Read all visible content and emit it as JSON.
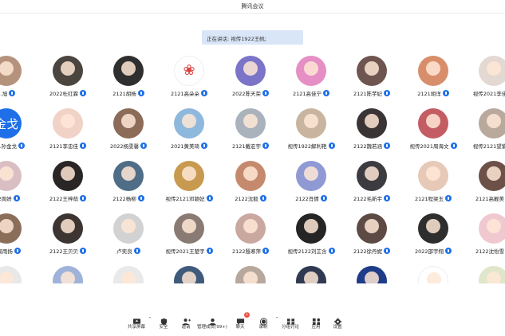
{
  "window": {
    "title": "腾讯会议"
  },
  "speaker": {
    "text": "正在讲话: 视传1922王帆;"
  },
  "participants": [
    {
      "name": "...旭",
      "avatar_color": "#b5927c",
      "avatar_text": ""
    },
    {
      "name": "2022杜红霖",
      "avatar_color": "#4b4540",
      "avatar_text": ""
    },
    {
      "name": "2121胡杨",
      "avatar_color": "#2f2f2f",
      "avatar_text": ""
    },
    {
      "name": "2121高朵朵",
      "avatar_color": "#ffffff",
      "avatar_text": "❀"
    },
    {
      "name": "2022陈天荣",
      "avatar_color": "#7b74c9",
      "avatar_text": ""
    },
    {
      "name": "2121高佳宁",
      "avatar_color": "#e68fc4",
      "avatar_text": ""
    },
    {
      "name": "2121陈芋妃",
      "avatar_color": "#6e5550",
      "avatar_text": ""
    },
    {
      "name": "2121胡洋",
      "avatar_color": "#d98e6b",
      "avatar_text": ""
    },
    {
      "name": "视传2021李佳",
      "avatar_color": "#e3d8d2",
      "avatar_text": ""
    },
    {
      "name": "2121孙金戈",
      "avatar_color": "#1e6fe8",
      "avatar_text": "金戈"
    },
    {
      "name": "2121李忠佳",
      "avatar_color": "#f0d2c6",
      "avatar_text": ""
    },
    {
      "name": "2022杨雯馨",
      "avatar_color": "#8c6b58",
      "avatar_text": ""
    },
    {
      "name": "2021黄美琦",
      "avatar_color": "#8fb8dd",
      "avatar_text": ""
    },
    {
      "name": "2121戴宏宇",
      "avatar_color": "#aab2bc",
      "avatar_text": ""
    },
    {
      "name": "视传1922解利艳",
      "avatar_color": "#c9b59f",
      "avatar_text": ""
    },
    {
      "name": "2122魏若涵",
      "avatar_color": "#3a3434",
      "avatar_text": ""
    },
    {
      "name": "视传2021周海文",
      "avatar_color": "#c45d63",
      "avatar_text": ""
    },
    {
      "name": "视传2121望紫",
      "avatar_color": "#b9a89c",
      "avatar_text": ""
    },
    {
      "name": "...2周妍",
      "avatar_color": "#d9bfc4",
      "avatar_text": ""
    },
    {
      "name": "2122王梓萌",
      "avatar_color": "#2b2626",
      "avatar_text": ""
    },
    {
      "name": "2122杨柳",
      "avatar_color": "#4f6d86",
      "avatar_text": ""
    },
    {
      "name": "视传2121邓颖妃",
      "avatar_color": "#c79a4f",
      "avatar_text": ""
    },
    {
      "name": "2122沈毅",
      "avatar_color": "#c58a6d",
      "avatar_text": ""
    },
    {
      "name": "2122肖倩",
      "avatar_color": "#8f99d4",
      "avatar_text": ""
    },
    {
      "name": "2122毛新宇",
      "avatar_color": "#3b3b40",
      "avatar_text": ""
    },
    {
      "name": "2121程梁玉",
      "avatar_color": "#e7c9b8",
      "avatar_text": ""
    },
    {
      "name": "2121高靓美",
      "avatar_color": "#6d5048",
      "avatar_text": ""
    },
    {
      "name": "...周雨扬",
      "avatar_color": "#8b6e5a",
      "avatar_text": ""
    },
    {
      "name": "2122王贝贝",
      "avatar_color": "#3c3532",
      "avatar_text": ""
    },
    {
      "name": "卢奕良",
      "avatar_color": "#d2d2d2",
      "avatar_text": ""
    },
    {
      "name": "视传2021王楚宇",
      "avatar_color": "#8a7a74",
      "avatar_text": ""
    },
    {
      "name": "2122殷寒萍",
      "avatar_color": "#c9a8a0",
      "avatar_text": ""
    },
    {
      "name": "视传2122刘芷含",
      "avatar_color": "#252525",
      "avatar_text": ""
    },
    {
      "name": "2122徐丹妮",
      "avatar_color": "#5e4a44",
      "avatar_text": ""
    },
    {
      "name": "2022邵宇翔",
      "avatar_color": "#2e2e2e",
      "avatar_text": ""
    },
    {
      "name": "2122沈怡雪",
      "avatar_color": "#f0c8cf",
      "avatar_text": ""
    },
    {
      "name": "",
      "avatar_color": "#e8e8e8",
      "avatar_text": ""
    },
    {
      "name": "",
      "avatar_color": "#9fb3d9",
      "avatar_text": ""
    },
    {
      "name": "",
      "avatar_color": "#e9e9e9",
      "avatar_text": ""
    },
    {
      "name": "",
      "avatar_color": "#3f5a7a",
      "avatar_text": ""
    },
    {
      "name": "",
      "avatar_color": "#b8a79c",
      "avatar_text": ""
    },
    {
      "name": "",
      "avatar_color": "#2f3a52",
      "avatar_text": ""
    },
    {
      "name": "",
      "avatar_color": "#1f3c88",
      "avatar_text": ""
    },
    {
      "name": "",
      "avatar_color": "#ffffff",
      "avatar_text": ""
    },
    {
      "name": "",
      "avatar_color": "#dfe6c9",
      "avatar_text": ""
    }
  ],
  "toolbar": [
    {
      "label": "共享屏幕",
      "icon": "share-screen-icon",
      "caret": true
    },
    {
      "label": "安全",
      "icon": "shield-icon",
      "caret": false
    },
    {
      "label": "邀请",
      "icon": "invite-icon",
      "caret": false
    },
    {
      "label": "管理成员(99+)",
      "icon": "members-icon",
      "caret": false
    },
    {
      "label": "聊天",
      "icon": "chat-icon",
      "caret": false,
      "badge": "1"
    },
    {
      "label": "录制",
      "icon": "record-icon",
      "caret": true
    },
    {
      "label": "分组讨论",
      "icon": "breakout-icon",
      "caret": false
    },
    {
      "label": "应用",
      "icon": "apps-icon",
      "caret": false
    },
    {
      "label": "设置",
      "icon": "gear-icon",
      "caret": false
    }
  ],
  "colors": {
    "accent": "#1e6fe8",
    "speaker_bg": "#d9e6f8",
    "badge": "#e54444"
  }
}
